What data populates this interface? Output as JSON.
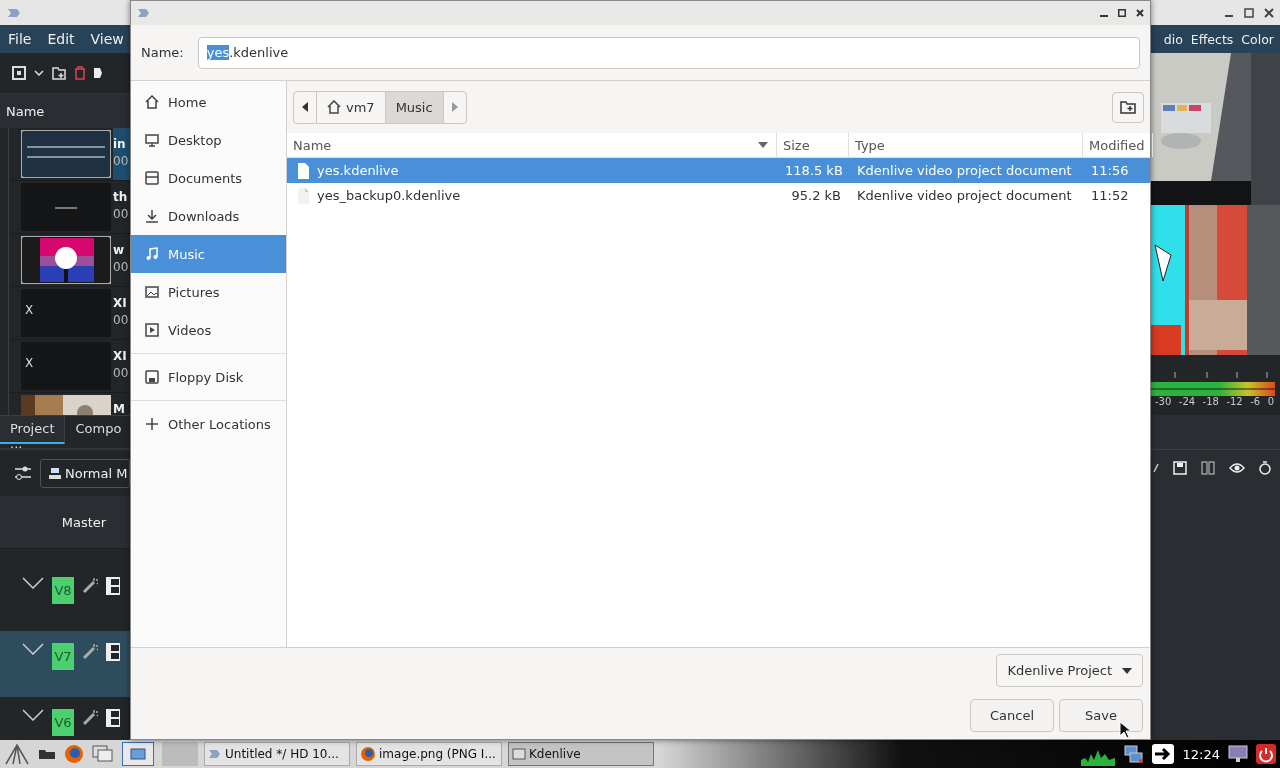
{
  "editor": {
    "menu": [
      "File",
      "Edit",
      "View"
    ],
    "menu_right": [
      "dio",
      "Effects",
      "Color"
    ],
    "bin_header": "Name",
    "clips": [
      {
        "title": "in",
        "duration": "00",
        "kind": "textcard",
        "selected": true
      },
      {
        "title": "th",
        "duration": "00",
        "kind": "darkcard",
        "selected": false
      },
      {
        "title": "w",
        "duration": "00",
        "kind": "flag",
        "selected": false
      },
      {
        "title": "XI",
        "duration": "00",
        "kind": "missing",
        "thumb_label": "X",
        "selected": false
      },
      {
        "title": "XI",
        "duration": "00",
        "kind": "missing",
        "thumb_label": "X",
        "selected": false
      },
      {
        "title": "M",
        "selected": false
      }
    ],
    "bin_tabs": [
      {
        "label": "Project ...",
        "selected": true
      },
      {
        "label": "Compo",
        "selected": false
      }
    ],
    "composition_mode": "Normal M",
    "mixer_title": "Master",
    "tracks": [
      {
        "name": "V8",
        "selected": false
      },
      {
        "name": "V7",
        "selected": true
      },
      {
        "name": "V6",
        "selected": false
      }
    ],
    "meter_ticks": [
      "-30",
      "-24",
      "-18",
      "-12",
      "-6",
      "0"
    ]
  },
  "dialog": {
    "name_label": "Name:",
    "name_selected": "yes",
    "name_rest": ".kdenlive",
    "place_groups": [
      [
        {
          "label": "Home",
          "kind": "home",
          "selected": false
        },
        {
          "label": "Desktop",
          "kind": "desktop",
          "selected": false
        },
        {
          "label": "Documents",
          "kind": "documents",
          "selected": false
        },
        {
          "label": "Downloads",
          "kind": "downloads",
          "selected": false
        },
        {
          "label": "Music",
          "kind": "music",
          "selected": true
        },
        {
          "label": "Pictures",
          "kind": "pictures",
          "selected": false
        },
        {
          "label": "Videos",
          "kind": "videos",
          "selected": false
        }
      ],
      [
        {
          "label": "Floppy Disk",
          "kind": "drive",
          "selected": false
        }
      ],
      [
        {
          "label": "Other Locations",
          "kind": "add",
          "selected": false
        }
      ]
    ],
    "path": [
      {
        "label": "vm7",
        "kind": "home",
        "selected": false
      },
      {
        "label": "Music",
        "kind": "folder",
        "selected": true
      }
    ],
    "columns": [
      {
        "label": "Name",
        "sorted": true
      },
      {
        "label": "Size",
        "sorted": false
      },
      {
        "label": "Type",
        "sorted": false
      },
      {
        "label": "Modified",
        "sorted": false
      }
    ],
    "files": [
      {
        "name": "yes.kdenlive",
        "size": "118.5 kB",
        "type": "Kdenlive video project document",
        "modified": "11:56",
        "selected": true
      },
      {
        "name": "yes_backup0.kdenlive",
        "size": "95.2 kB",
        "type": "Kdenlive video project document",
        "modified": "11:52",
        "selected": false
      }
    ],
    "filter": "Kdenlive Project",
    "buttons": [
      {
        "label": "Cancel"
      },
      {
        "label": "Save"
      }
    ]
  },
  "taskbar": {
    "tasks": [
      {
        "label": "Untitled */ HD 10...",
        "selected": false
      },
      {
        "label": "image.png (PNG I...",
        "selected": false
      },
      {
        "label": "Kdenlive",
        "selected": true
      }
    ],
    "clock": "12:24"
  }
}
